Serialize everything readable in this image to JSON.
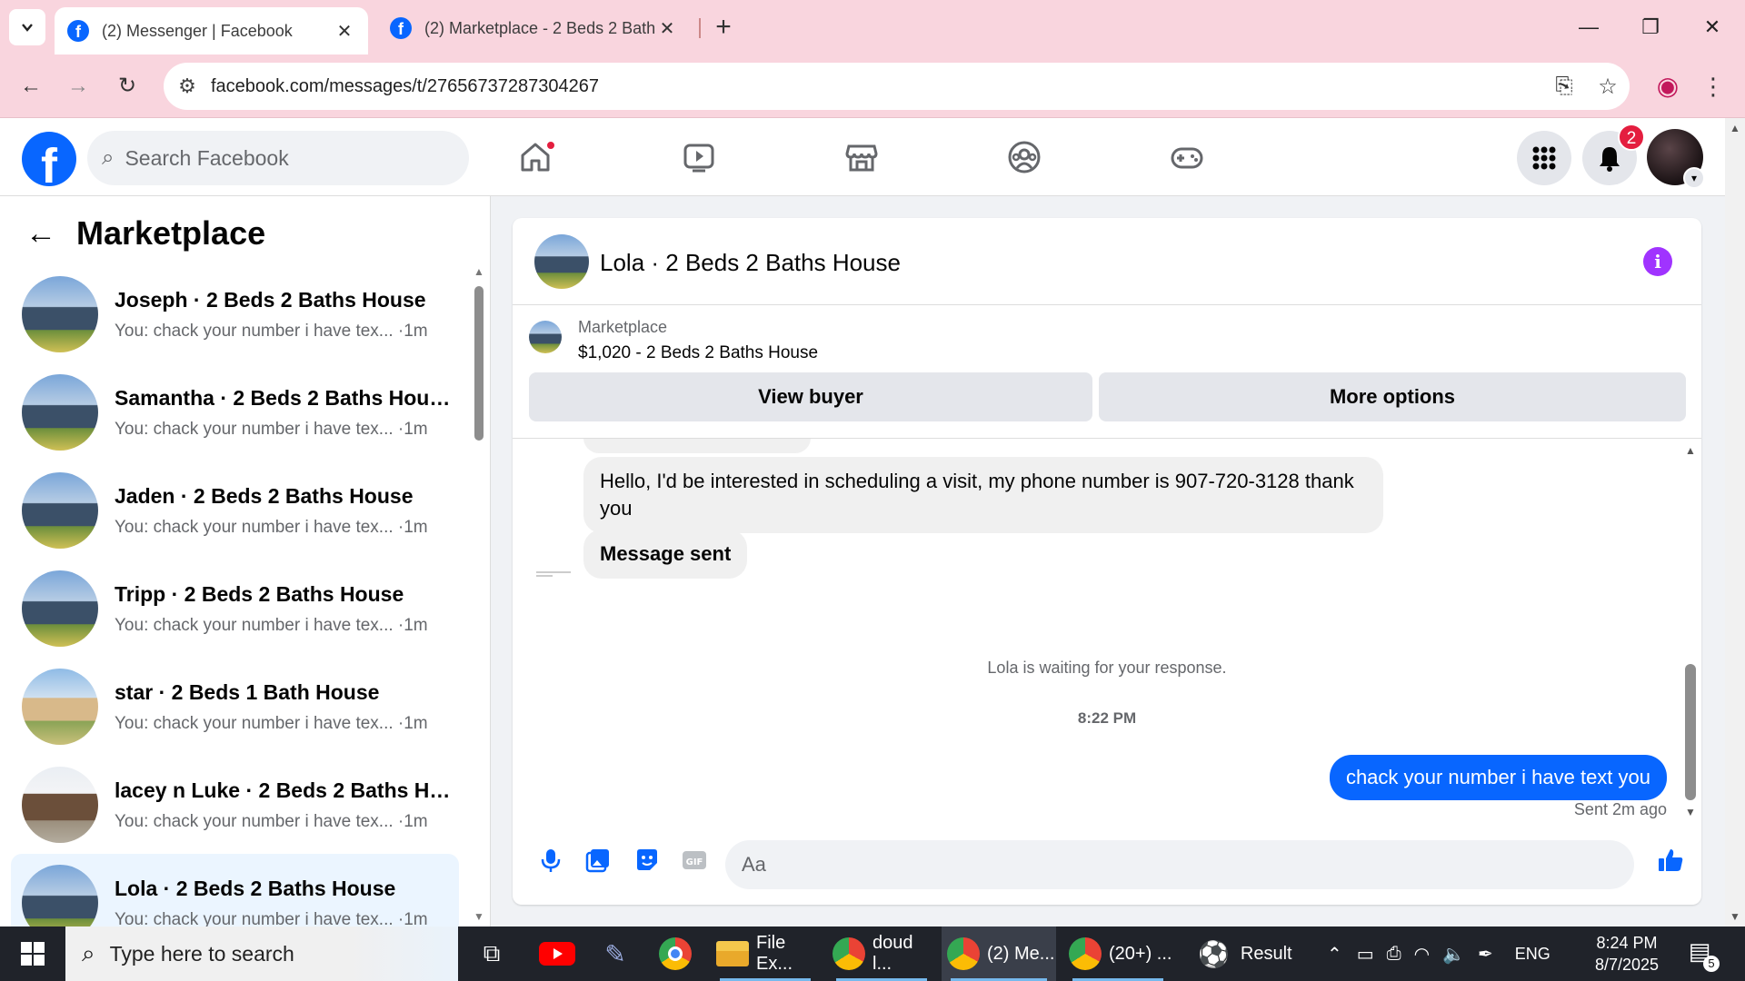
{
  "browser": {
    "tabs": [
      {
        "title": "(2) Messenger | Facebook",
        "active": true
      },
      {
        "title": "(2) Marketplace - 2 Beds 2 Bath",
        "active": false
      }
    ],
    "url": "facebook.com/messages/t/27656737287304267"
  },
  "fb_header": {
    "search_placeholder": "Search Facebook",
    "notifications_count": "2",
    "nav": [
      "home-icon",
      "video-icon",
      "marketplace-icon",
      "groups-icon",
      "gaming-icon"
    ]
  },
  "sidebar": {
    "title": "Marketplace",
    "conversations": [
      {
        "name": "Joseph · 2 Beds 2 Baths House",
        "preview": "You: chack your number i have tex... ·1m",
        "thumb": "house"
      },
      {
        "name": "Samantha · 2 Beds 2 Baths House",
        "preview": "You: chack your number i have tex... ·1m",
        "thumb": "house"
      },
      {
        "name": "Jaden · 2 Beds 2 Baths House",
        "preview": "You: chack your number i have tex... ·1m",
        "thumb": "house"
      },
      {
        "name": "Tripp · 2 Beds 2 Baths House",
        "preview": "You: chack your number i have tex... ·1m",
        "thumb": "house"
      },
      {
        "name": "star · 2 Beds 1 Bath House",
        "preview": "You: chack your number i have tex... ·1m",
        "thumb": "cabin"
      },
      {
        "name": "lacey n Luke · 2 Beds 2 Baths Ho...",
        "preview": "You: chack your number i have tex... ·1m",
        "thumb": "log"
      },
      {
        "name": "Lola · 2 Beds 2 Baths House",
        "preview": "You: chack your number i have tex... ·1m",
        "thumb": "house",
        "selected": true
      }
    ]
  },
  "chat": {
    "title": "Lola · 2 Beds 2 Baths House",
    "listing": {
      "label": "Marketplace",
      "value": "$1,020 - 2 Beds 2 Baths House",
      "view_buyer": "View buyer",
      "more_options": "More options"
    },
    "messages": {
      "incoming_1": "Hello, I'd be interested in scheduling a visit, my phone number is 907-720-3128 thank you",
      "incoming_2": "Message sent",
      "waiting_note": "Lola is waiting for your response.",
      "time": "8:22 PM",
      "outgoing": "chack your number i have text you",
      "sent_status": "Sent 2m ago"
    },
    "composer_placeholder": "Aa"
  },
  "taskbar": {
    "search_placeholder": "Type here to search",
    "apps": [
      {
        "label": "File Ex...",
        "icon": "file-explorer-icon"
      },
      {
        "label": "doud l...",
        "icon": "chrome-icon"
      },
      {
        "label": "(2) Me...",
        "icon": "chrome-icon"
      },
      {
        "label": "(20+) ...",
        "icon": "chrome-icon"
      }
    ],
    "weather_label": "Result",
    "language": "ENG",
    "time": "8:24 PM",
    "date": "8/7/2025",
    "notification_count": "5"
  }
}
